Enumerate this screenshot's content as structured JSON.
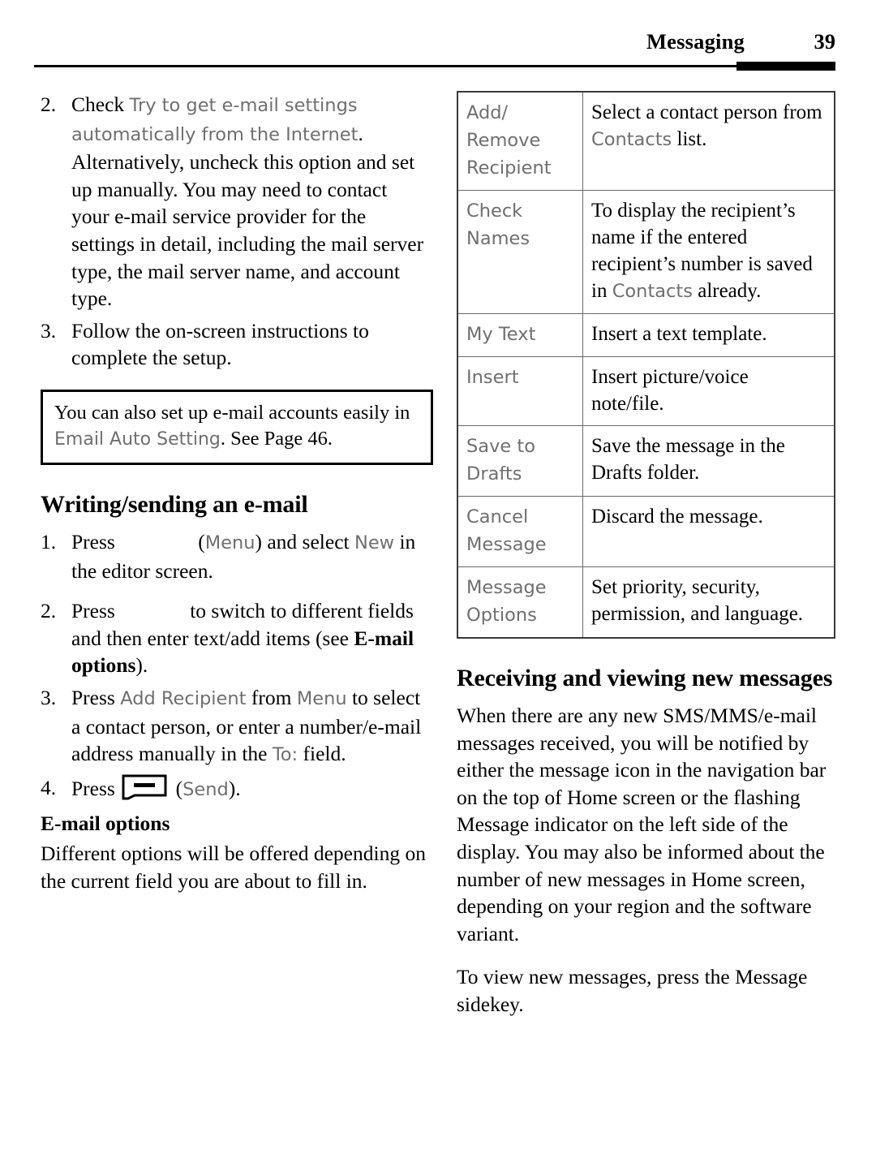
{
  "header": {
    "title": "Messaging",
    "page_number": "39"
  },
  "left_column": {
    "steps_setup": [
      {
        "number": "2.",
        "segments": [
          {
            "text": "Check ",
            "style": "body"
          },
          {
            "text": "Try to get e-mail settings automatically from the Internet",
            "style": "ui"
          },
          {
            "text": ". Alternatively, uncheck this option and set up manually. You may need to contact your e-mail service provider for the settings in detail, including the mail server type, the mail server name, and account type.",
            "style": "body"
          }
        ]
      },
      {
        "number": "3.",
        "segments": [
          {
            "text": "Follow the on-screen instructions to complete the setup.",
            "style": "body"
          }
        ]
      }
    ],
    "note_box": {
      "part1": "You can also set up e-mail accounts easily in ",
      "ui_term": "Email Auto Setting",
      "part2": ". See Page 46."
    },
    "heading_writing": "Writing/sending an e-mail",
    "steps_writing": [
      {
        "number": "1.",
        "pre": "Press ",
        "paren_open": "(",
        "ui_menu": "Menu",
        "paren_close": ") and select ",
        "ui_new": "New",
        "post": " in the editor screen."
      },
      {
        "number": "2.",
        "pre": "Press ",
        "mid": "to switch to different fields and then enter text/add items (see ",
        "bold_term": "E-mail options",
        "post": ")."
      },
      {
        "number": "3.",
        "pre": "Press ",
        "ui_add_recipient": "Add Recipient",
        "mid": " from ",
        "ui_menu": "Menu",
        "mid2": " to select a contact person, or enter a number/e-mail address manually in the ",
        "ui_to": "To:",
        "post": " field."
      },
      {
        "number": "4.",
        "pre": "Press ",
        "icon": "softkey-icon",
        "paren_open": " (",
        "ui_send": "Send",
        "paren_close": ")."
      }
    ],
    "heading_email_options": "E-mail options",
    "email_options_body": "Different options will be offered depending on the current field you are about to fill in."
  },
  "right_column": {
    "options_table": {
      "rows": [
        {
          "term": "Add/\nRemove\nRecipient",
          "desc_part1": "Select a contact person from ",
          "desc_ui": "Contacts",
          "desc_part2": " list."
        },
        {
          "term": "Check\nNames",
          "desc_part1": "To display the recipient’s name if the entered recipient’s number is saved in ",
          "desc_ui": "Contacts",
          "desc_part2": " already."
        },
        {
          "term": "My Text",
          "desc_part1": "Insert a text template.",
          "desc_ui": "",
          "desc_part2": ""
        },
        {
          "term": "Insert",
          "desc_part1": "Insert picture/voice note/file.",
          "desc_ui": "",
          "desc_part2": ""
        },
        {
          "term": "Save to\nDrafts",
          "desc_part1": "Save the message in the Drafts folder.",
          "desc_ui": "",
          "desc_part2": ""
        },
        {
          "term": "Cancel\nMessage",
          "desc_part1": "Discard the message.",
          "desc_ui": "",
          "desc_part2": ""
        },
        {
          "term": "Message\nOptions",
          "desc_part1": "Set priority, security, permission, and language.",
          "desc_ui": "",
          "desc_part2": ""
        }
      ]
    },
    "heading_receiving": "Receiving and viewing new messages",
    "paragraph_1": "When there are any new SMS/MMS/e-mail messages received, you will be notified by either the message icon in the navigation bar on the top of Home screen or the flashing Message indicator on the left side of the display. You may also be informed about the number of new messages in Home screen, depending on your region and the software variant.",
    "paragraph_2": "To view new messages, press the Message sidekey."
  },
  "colors": {
    "ui_term_gray": "#6f6f6f",
    "text_black": "#000000",
    "table_border": "#6a6a6a",
    "table_outer_border": "#3a3a3a"
  }
}
